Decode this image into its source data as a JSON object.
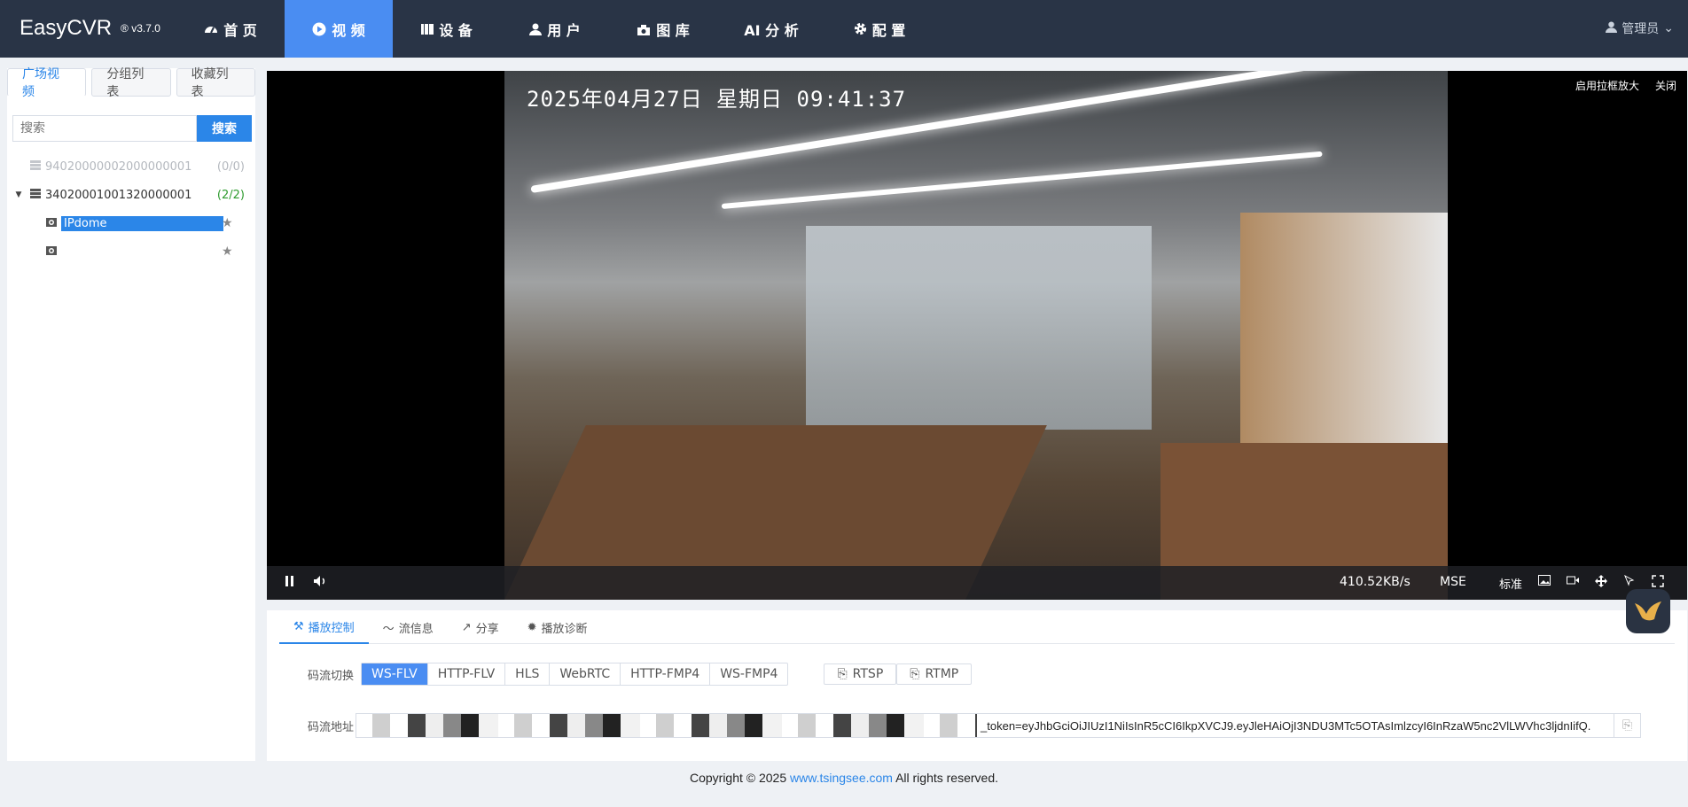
{
  "app": {
    "name": "EasyCVR",
    "version": "® v3.7.0"
  },
  "nav": {
    "items": [
      {
        "label": "首 页",
        "icon": "dashboard-icon"
      },
      {
        "label": "视 频",
        "icon": "play-icon"
      },
      {
        "label": "设 备",
        "icon": "device-icon"
      },
      {
        "label": "用 户",
        "icon": "user-icon"
      },
      {
        "label": "图 库",
        "icon": "gallery-icon"
      },
      {
        "label": "AI 分 析",
        "icon": ""
      },
      {
        "label": "配 置",
        "icon": "gear-icon"
      }
    ],
    "user": "管理员"
  },
  "sidebar": {
    "tabs": [
      "广场视频",
      "分组列表",
      "收藏列表"
    ],
    "search": {
      "placeholder": "搜索",
      "button": "搜索"
    },
    "tree": [
      {
        "id": "94020000002000000001",
        "count": "(0/0)"
      },
      {
        "id": "34020001001320000001",
        "count": "(2/2)"
      }
    ],
    "channels": [
      {
        "label": "IPdome"
      },
      {
        "label": ""
      }
    ]
  },
  "player": {
    "osd_time": "2025年04月27日  星期日  09:41:37",
    "top_buttons": [
      "启用拉框放大",
      "关闭"
    ],
    "bitrate": "410.52KB/s",
    "mode": "MSE",
    "quality": "标准"
  },
  "panel": {
    "tabs": [
      "播放控制",
      "流信息",
      "分享",
      "播放诊断"
    ],
    "stream_switch_label": "码流切换",
    "protocols": [
      "WS-FLV",
      "HTTP-FLV",
      "HLS",
      "WebRTC",
      "HTTP-FMP4",
      "WS-FMP4"
    ],
    "active_protocol": "WS-FLV",
    "copy_buttons": [
      "RTSP",
      "RTMP"
    ],
    "stream_url_label": "码流地址",
    "stream_url_token": "_token=eyJhbGciOiJIUzI1NiIsInR5cCI6IkpXVCJ9.eyJleHAiOjI3NDU3MTc5OTAsImlzcyI6InRzaW5nc2VlLWVhc3ljdnIifQ."
  },
  "footer": {
    "prefix": "Copyright © 2025 ",
    "link": "www.tsingsee.com",
    "suffix": " All rights reserved."
  }
}
